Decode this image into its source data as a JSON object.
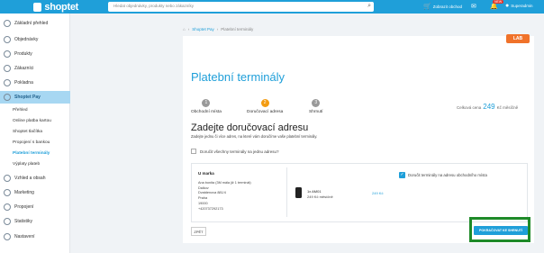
{
  "topbar": {
    "logo": "shoptet",
    "search_placeholder": "Hledat objednávky, produkty nebo zákazníky",
    "links": [
      {
        "label": "Zobrazit obchod",
        "icon": "cart-icon"
      },
      {
        "label": "",
        "icon": "help-icon"
      },
      {
        "label": "",
        "icon": "bell-icon"
      },
      {
        "label": "Superadmin",
        "icon": "user-icon"
      }
    ],
    "new_badge": "NEW"
  },
  "sidebar": {
    "items": [
      {
        "label": "Základní přehled",
        "icon": "dashboard-icon"
      },
      {
        "label": "Objednávky",
        "icon": "orders-icon"
      },
      {
        "label": "Produkty",
        "icon": "products-icon"
      },
      {
        "label": "Zákazníci",
        "icon": "customers-icon"
      },
      {
        "label": "Pokladna",
        "icon": "register-icon"
      },
      {
        "label": "Shoptet Pay",
        "icon": "pay-icon"
      },
      {
        "label": "Vzhled a obsah",
        "icon": "appearance-icon"
      },
      {
        "label": "Marketing",
        "icon": "marketing-icon"
      },
      {
        "label": "Propojení",
        "icon": "connections-icon"
      },
      {
        "label": "Statistiky",
        "icon": "stats-icon"
      },
      {
        "label": "Nastavení",
        "icon": "settings-icon"
      }
    ],
    "subitems": [
      "Přehled",
      "Online platba kartou",
      "Shoptet tlačítka",
      "Propojení s bankou",
      "Platební terminály",
      "Výplaty plateb"
    ]
  },
  "breadcrumb": {
    "items": [
      "Shoptet Pay",
      "Platební terminály"
    ]
  },
  "lab_badge": "LAB",
  "page_title": "Platební terminály",
  "steps": [
    {
      "number": "1",
      "label": "Obchodní místa"
    },
    {
      "number": "2",
      "label": "Doručovací adresa"
    },
    {
      "number": "3",
      "label": "Shrnutí"
    }
  ],
  "price": {
    "prefix": "Celková cena",
    "amount": "249",
    "suffix": "Kč měsíčně"
  },
  "section_title": "Zadejte doručovací adresu",
  "section_subtitle": "Zadejte jednu či více adres, na které vám doručíme vaše platební terminály.",
  "deliver_all_label": "Doručit všechny terminály na jednu adresu?",
  "address": {
    "name": "U marka",
    "lines": [
      "Ana bonita (3M mála již 1 terminál)",
      "Dalkov",
      "Dvatdenova 881/4",
      "Praha",
      "19000",
      "+420737292173"
    ]
  },
  "product": {
    "name": "1x AM01",
    "price": "249 Kč měsíčně",
    "total": "249 Kč"
  },
  "deliver_to_shop_label": "Doručit terminály na adresu obchodního místa",
  "buttons": {
    "back": "ZPĚT",
    "continue": "POKRAČOVAT KE SHRNUTÍ"
  }
}
